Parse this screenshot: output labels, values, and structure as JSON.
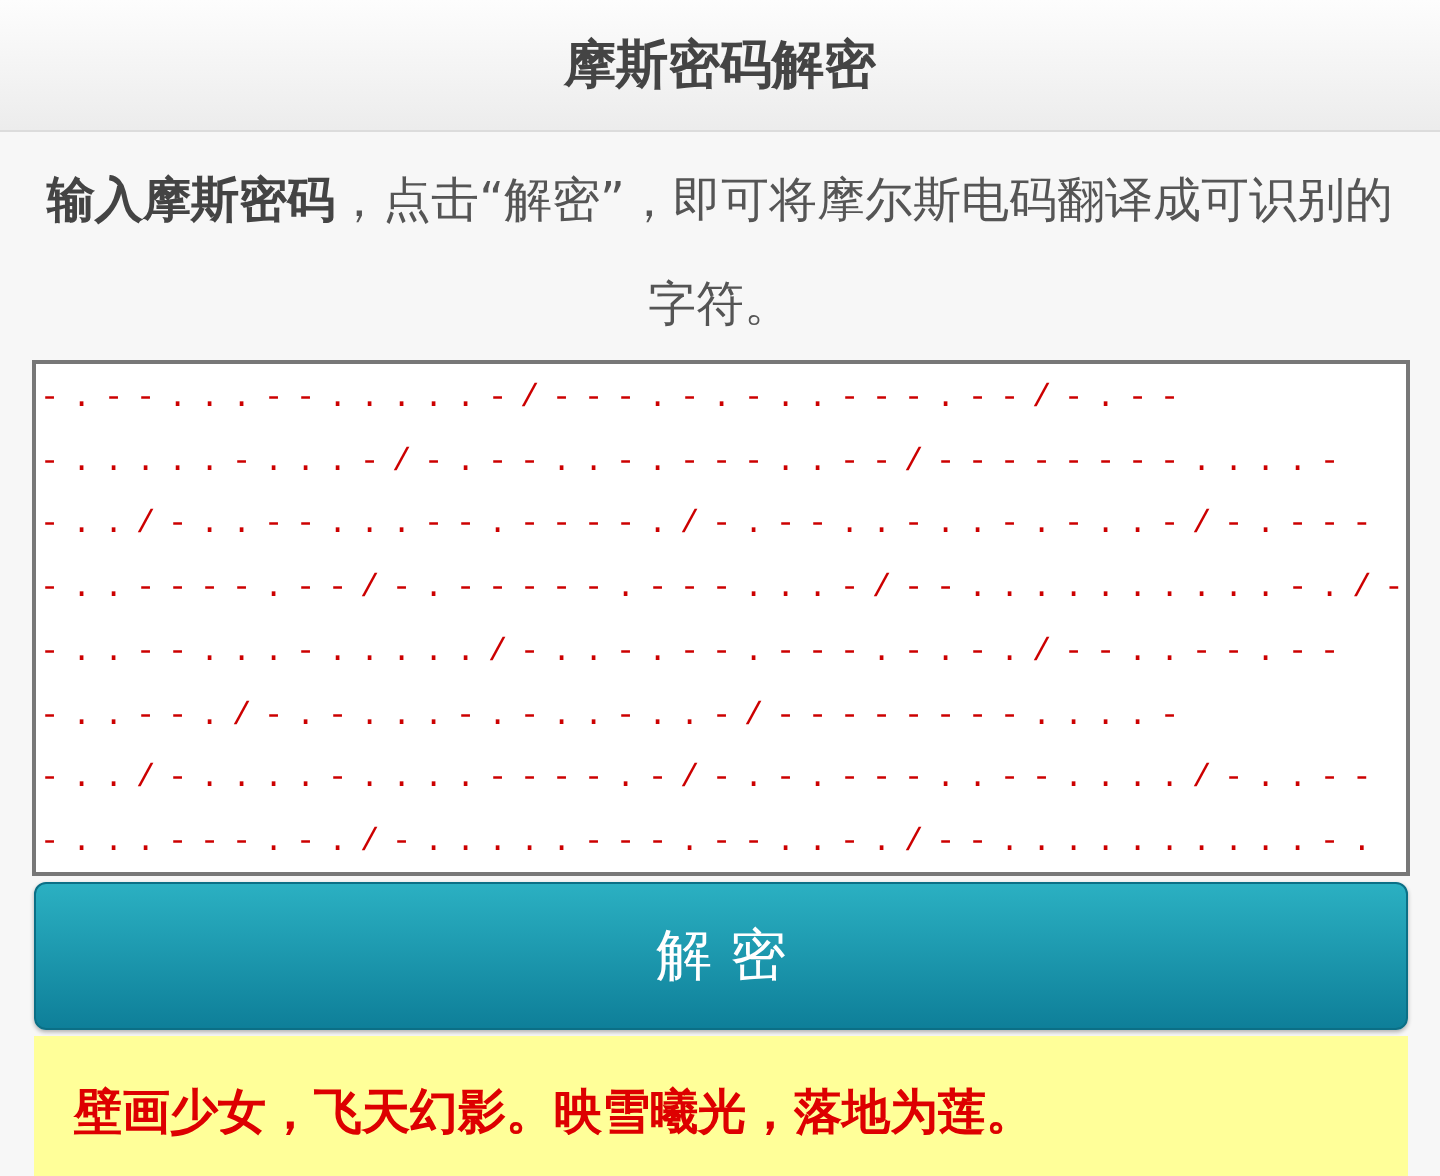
{
  "header": {
    "title": "摩斯密码解密"
  },
  "intro": "**输入摩斯密码**，点击“解密”，即可将摩尔斯电码翻译成可识别的字符。",
  "morse_input": {
    "value_lines": [
      "-.--...--.....-/---.-.-..---.--/-.--",
      "-.....-...-/-.--..-.---..--/--------....-",
      "-../-..--...--.----./-.--..-..-.-..-/-.---",
      "-..----.--/-.-----.---...-/--..........-./-",
      "-..--...-...../-..-.--.---.-.-./--..--.--",
      "-..--./-.-...-.-..-..-/--------....-",
      "-../-....-....----.-/-.-.---..--..../-..--",
      "-...---.-./-.....---.--..-./--..........-."
    ]
  },
  "decrypt_button": {
    "label": "解 密"
  },
  "result": {
    "text": "壁画少女，飞天幻影。映雪曦光，落地为莲。"
  }
}
